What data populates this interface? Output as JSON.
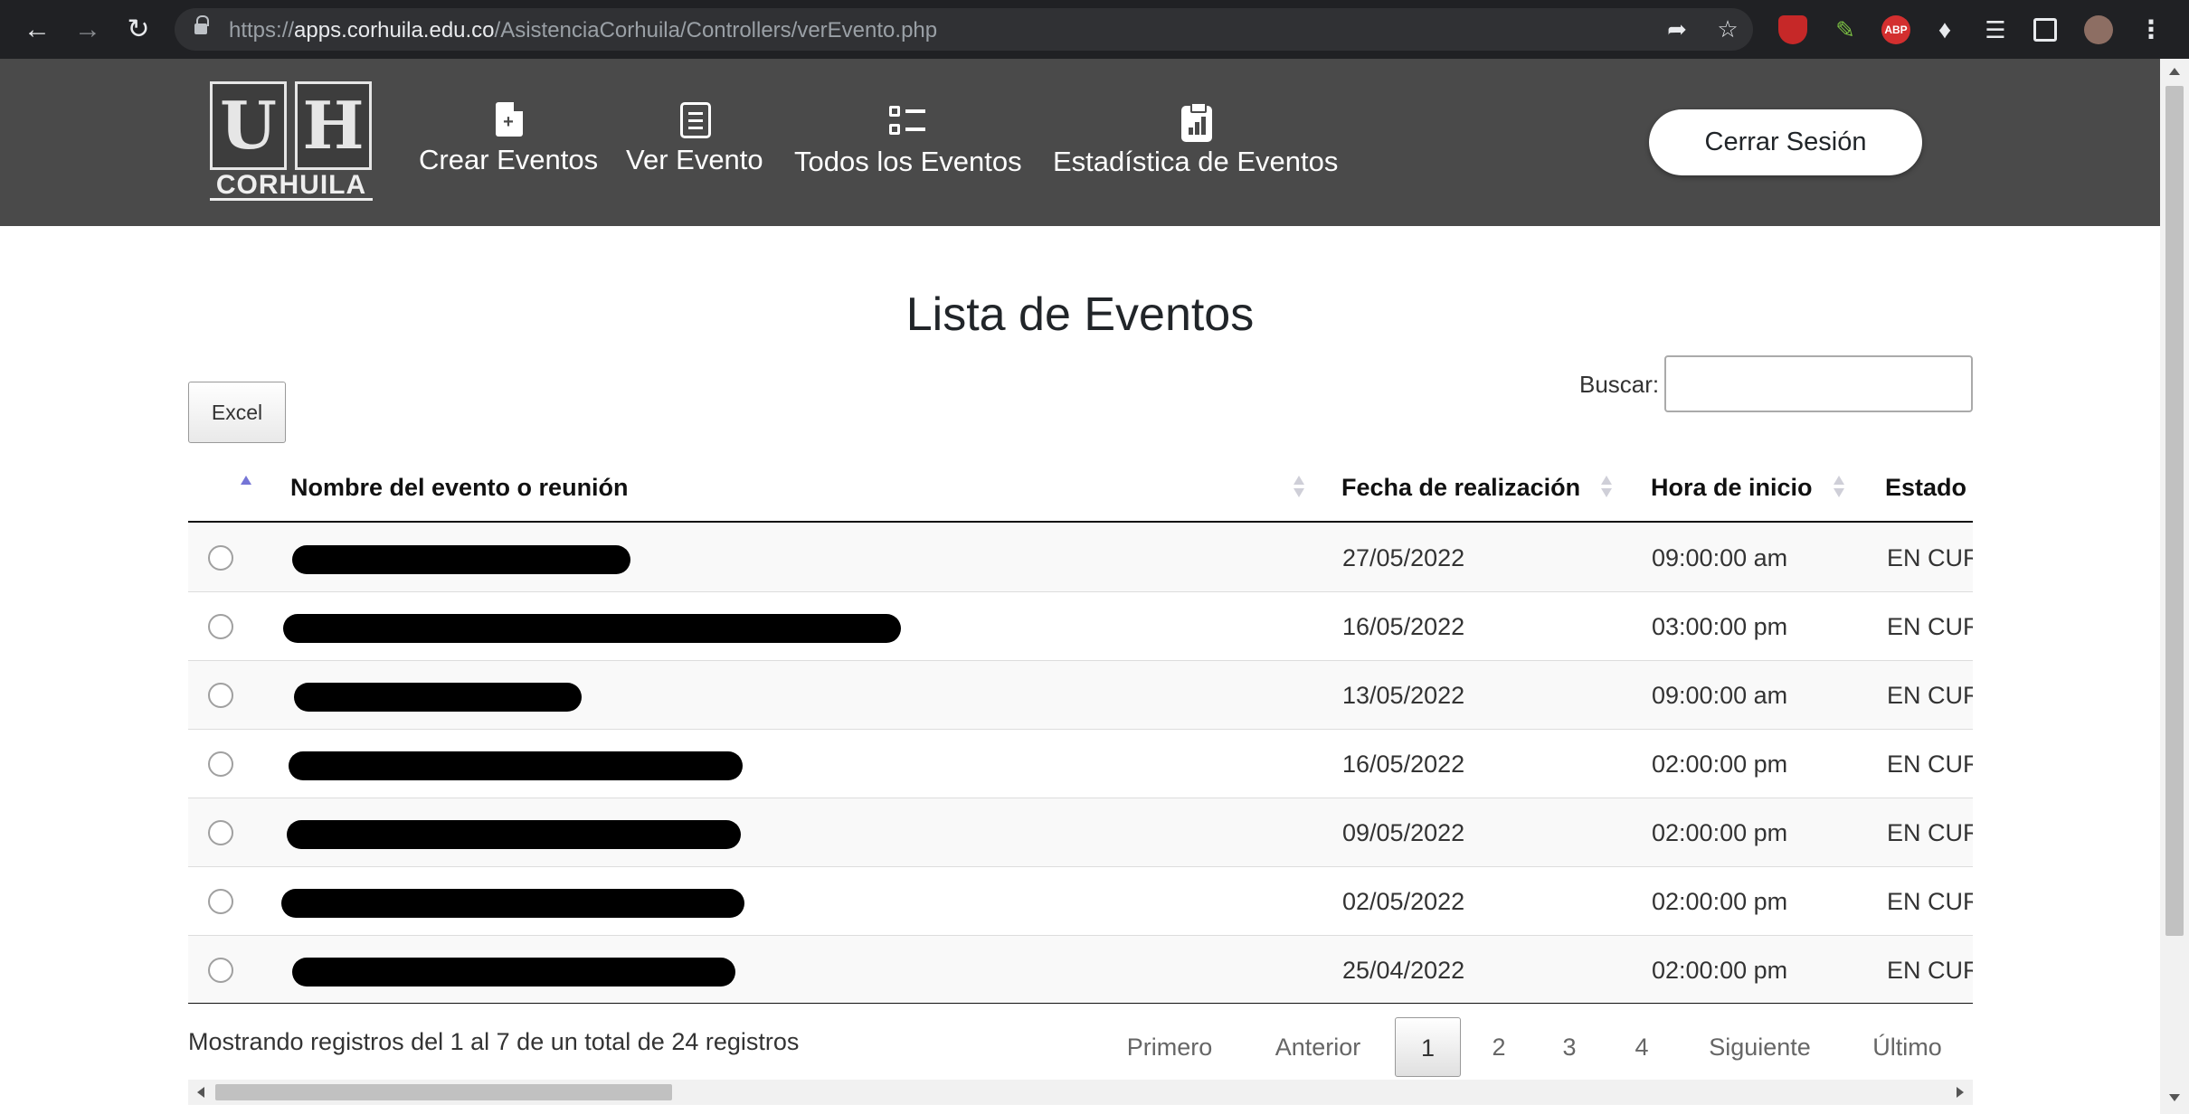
{
  "browser": {
    "url_scheme": "https://",
    "url_host": "apps.corhuila.edu.co",
    "url_path": "/AsistenciaCorhuila/Controllers/verEvento.php",
    "extensions": [
      "share-icon",
      "star-icon",
      "shield-icon",
      "eyedropper-icon",
      "abp-icon",
      "puzzle-icon",
      "media-icon",
      "sidepanel-icon",
      "profile-avatar",
      "menu-icon"
    ],
    "abp_label": "ABP"
  },
  "header": {
    "logo_text": "CORHUILA",
    "logo_letters": [
      "U",
      "H"
    ],
    "nav": [
      {
        "label": "Crear Eventos",
        "icon": "file-plus-icon"
      },
      {
        "label": "Ver Evento",
        "icon": "list-document-icon"
      },
      {
        "label": "Todos los Eventos",
        "icon": "checklist-icon"
      },
      {
        "label": "Estadística de Eventos",
        "icon": "clipboard-chart-icon"
      }
    ],
    "logout_label": "Cerrar Sesión"
  },
  "main": {
    "title": "Lista de Eventos",
    "excel_label": "Excel",
    "search_label": "Buscar:",
    "search_value": "",
    "columns": [
      "Nombre del evento o reunión",
      "Fecha de realización",
      "Hora de inicio",
      "Estado"
    ],
    "rows": [
      {
        "fecha": "27/05/2022",
        "hora": "09:00:00 am",
        "estado": "EN CUR"
      },
      {
        "fecha": "16/05/2022",
        "hora": "03:00:00 pm",
        "estado": "EN CUR"
      },
      {
        "fecha": "13/05/2022",
        "hora": "09:00:00 am",
        "estado": "EN CUR"
      },
      {
        "fecha": "16/05/2022",
        "hora": "02:00:00 pm",
        "estado": "EN CUR"
      },
      {
        "fecha": "09/05/2022",
        "hora": "02:00:00 pm",
        "estado": "EN CUR"
      },
      {
        "fecha": "02/05/2022",
        "hora": "02:00:00 pm",
        "estado": "EN CUR"
      },
      {
        "fecha": "25/04/2022",
        "hora": "02:00:00 pm",
        "estado": "EN CUR"
      }
    ],
    "info": "Mostrando registros del 1 al 7 de un total de 24 registros",
    "pagination": {
      "first": "Primero",
      "prev": "Anterior",
      "pages": [
        "1",
        "2",
        "3",
        "4"
      ],
      "current": "1",
      "next": "Siguiente",
      "last": "Último"
    }
  }
}
